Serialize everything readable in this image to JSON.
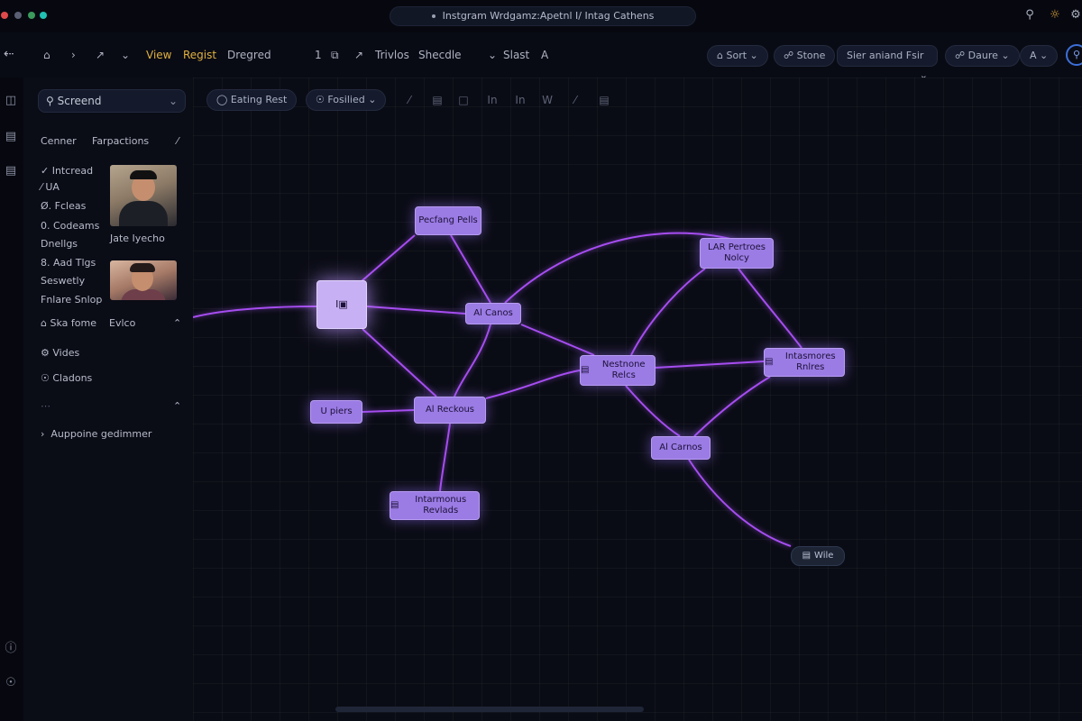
{
  "window": {
    "title": "Instgram Wrdgamz:Apetnl I/ Intag Cathens",
    "right_icons": [
      "search-icon",
      "bulb-icon",
      "settings-icon"
    ]
  },
  "toolbar": {
    "menu": [
      "View",
      "Regist",
      "Dregred"
    ],
    "count": "1",
    "tools": [
      "Trivlos",
      "Shecdle"
    ],
    "slast": "Slast",
    "a_label": "A",
    "sort_label": "Sort",
    "store_label": "Stone",
    "filter_value": "Sier aniand Fsir",
    "share_label": "Daure",
    "a_dropdown": "A"
  },
  "sidebar": {
    "search_value": "Screend",
    "tabs": [
      "Cenner",
      "Farpactions"
    ],
    "items": [
      {
        "icon": "check-icon",
        "label": "Intcread"
      },
      {
        "icon": "",
        "label": "⁄ UA"
      },
      {
        "icon": "",
        "label": "Ø. Fcleas"
      },
      {
        "icon": "",
        "label": "0. Codeams"
      },
      {
        "icon": "",
        "label": "Dnellgs"
      },
      {
        "icon": "",
        "label": "8. Aad Tlgs"
      },
      {
        "icon": "",
        "label": "Seswetly"
      },
      {
        "icon": "",
        "label": "Fnlare Snlop"
      }
    ],
    "profile_name": "Jate Iyecho",
    "section_label": "Ska fome",
    "section_value": "Evlco",
    "sub_items": [
      {
        "icon": "gear-icon",
        "label": "Vides"
      },
      {
        "icon": "globe-icon",
        "label": "Cladons"
      }
    ],
    "footer_item": "Auppoine gedimmer"
  },
  "canvas_toolbar": {
    "eating_label": "Eating Rest",
    "fosilied_label": "Fosilied"
  },
  "graph": {
    "nodes": [
      {
        "id": "hub",
        "label": "I▣"
      },
      {
        "id": "n1",
        "label": "Pecfang Pells"
      },
      {
        "id": "n2",
        "label": "Al Canos"
      },
      {
        "id": "n3",
        "label": "LAR Pertroes Nolcy"
      },
      {
        "id": "n4",
        "label": "Nestnone Relcs"
      },
      {
        "id": "n5",
        "label": "Intasmores Rnlres"
      },
      {
        "id": "n6",
        "label": "U piers"
      },
      {
        "id": "n7",
        "label": "Al Reckous"
      },
      {
        "id": "n8",
        "label": "Al Carnos"
      },
      {
        "id": "n9",
        "label": "Intarmonus Revlads"
      },
      {
        "id": "n10",
        "label": "Wile"
      }
    ],
    "accent_color": "#9b7be4",
    "edge_color": "#a64df0"
  }
}
